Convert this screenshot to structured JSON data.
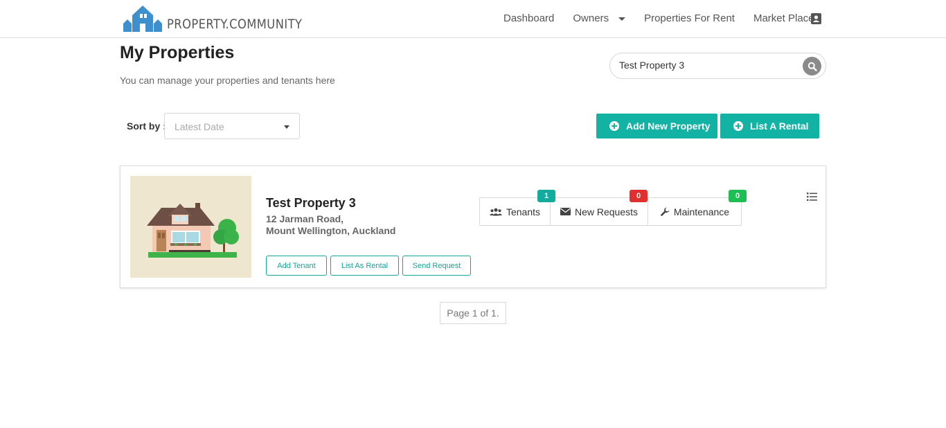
{
  "header": {
    "logo_text": "PROPERTY.COMMUNITY",
    "nav": {
      "dashboard": "Dashboard",
      "owners": "Owners",
      "properties_for_rent": "Properties For Rent",
      "market_place": "Market Place"
    },
    "profile_icon": "contact-card-icon"
  },
  "page": {
    "title": "My Properties",
    "subtitle": "You can manage your properties and tenants here"
  },
  "search": {
    "value": "Test Property 3",
    "icon": "search-icon"
  },
  "sort": {
    "label": "Sort by :",
    "selected": "Latest Date"
  },
  "actions": {
    "add_property": "Add New Property",
    "list_rental": "List A Rental"
  },
  "properties": [
    {
      "name": "Test Property 3",
      "address_line1": "12 Jarman Road,",
      "address_line2": "Mount Wellington, Auckland",
      "buttons": {
        "add_tenant": "Add Tenant",
        "list_as_rental": "List As Rental",
        "send_request": "Send Request"
      },
      "stats": {
        "tenants_label": "Tenants",
        "tenants_count": "1",
        "requests_label": "New Requests",
        "requests_count": "0",
        "maintenance_label": "Maintenance",
        "maintenance_count": "0"
      }
    }
  ],
  "pagination": {
    "text": "Page 1 of 1."
  },
  "colors": {
    "accent": "#12b2a5",
    "badge_red": "#e02f2f",
    "badge_green": "#1fbe55"
  }
}
